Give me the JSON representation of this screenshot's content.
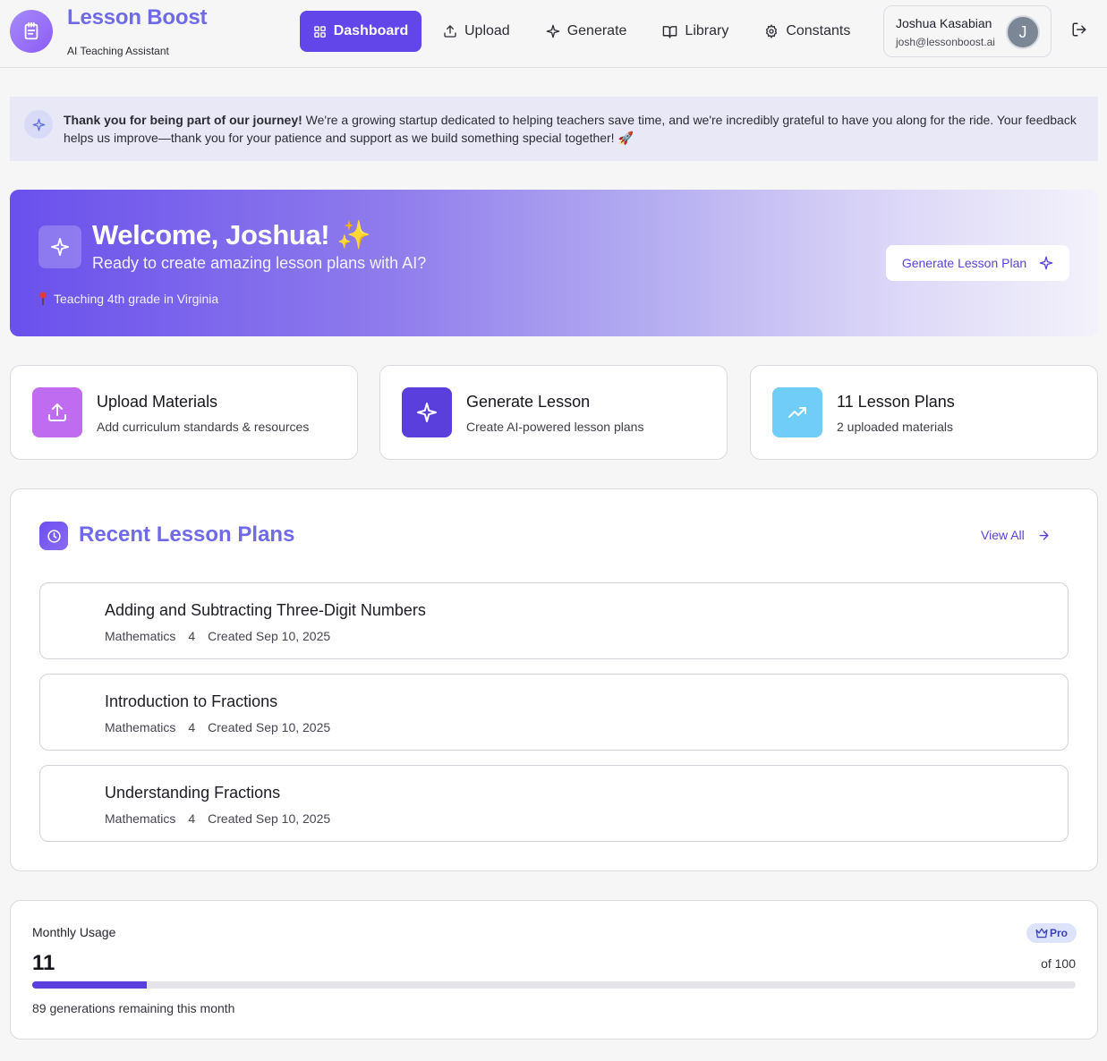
{
  "brand": {
    "title": "Lesson Boost",
    "subtitle": "AI Teaching Assistant",
    "icon": "notebook-icon"
  },
  "nav": {
    "items": [
      {
        "label": "Dashboard",
        "icon": "grid-icon",
        "active": true
      },
      {
        "label": "Upload",
        "icon": "upload-icon",
        "active": false
      },
      {
        "label": "Generate",
        "icon": "sparkle-icon",
        "active": false
      },
      {
        "label": "Library",
        "icon": "book-icon",
        "active": false
      },
      {
        "label": "Constants",
        "icon": "gear-icon",
        "active": false
      }
    ]
  },
  "user": {
    "name": "Joshua Kasabian",
    "email": "josh@lessonboost.ai",
    "initial": "J"
  },
  "notice": {
    "bold": "Thank you for being part of our journey!",
    "text": " We're a growing startup dedicated to helping teachers save time, and we're incredibly grateful to have you along for the ride. Your feedback helps us improve—thank you for your patience and support as we build something special together! 🚀"
  },
  "hero": {
    "title": "Welcome, Joshua! ✨",
    "subtitle": "Ready to create amazing lesson plans with AI?",
    "location": "Teaching 4th grade in Virginia",
    "button_label": "Generate Lesson Plan"
  },
  "quick_cards": [
    {
      "title": "Upload Materials",
      "subtitle": "Add curriculum standards & resources",
      "icon": "upload-icon",
      "color": "#c06cf0"
    },
    {
      "title": "Generate Lesson",
      "subtitle": "Create AI-powered lesson plans",
      "icon": "sparkle-icon",
      "color": "#5a3fdc"
    },
    {
      "title": "11 Lesson Plans",
      "subtitle": "2 uploaded materials",
      "icon": "trending-up-icon",
      "color": "#6fcdf7"
    }
  ],
  "recent": {
    "title": "Recent Lesson Plans",
    "view_all_label": "View All",
    "plans": [
      {
        "title": "Adding and Subtracting Three-Digit Numbers",
        "subject": "Mathematics",
        "grade": "4",
        "created": "Created Sep 10, 2025"
      },
      {
        "title": "Introduction to Fractions",
        "subject": "Mathematics",
        "grade": "4",
        "created": "Created Sep 10, 2025"
      },
      {
        "title": "Understanding Fractions",
        "subject": "Mathematics",
        "grade": "4",
        "created": "Created Sep 10, 2025"
      }
    ]
  },
  "usage": {
    "label": "Monthly Usage",
    "badge": "Pro",
    "count": "11",
    "limit_label": "of 100",
    "fraction_used": 0.11,
    "remaining_label": "89 generations remaining this month"
  },
  "colors": {
    "accent": "#6246ea",
    "brand_text": "#6f6ae8"
  }
}
